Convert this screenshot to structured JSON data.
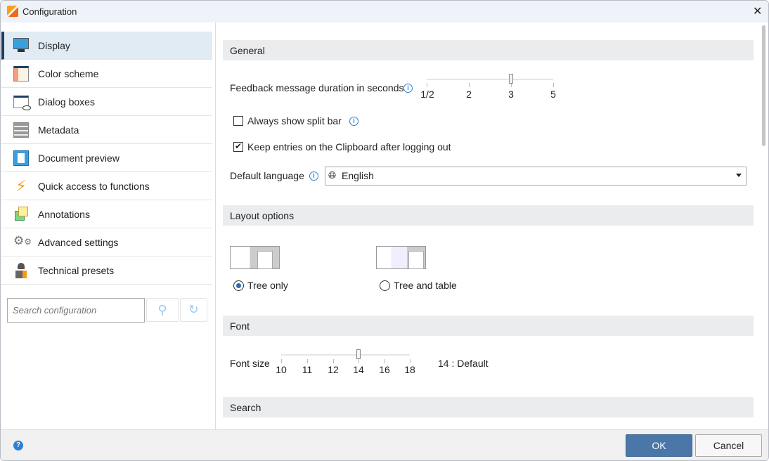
{
  "window": {
    "title": "Configuration",
    "close": "✕"
  },
  "sidebar": {
    "items": [
      {
        "label": "Display",
        "icon": "monitor-icon",
        "selected": true
      },
      {
        "label": "Color scheme",
        "icon": "color-scheme-icon"
      },
      {
        "label": "Dialog boxes",
        "icon": "dialog-eye-icon"
      },
      {
        "label": "Metadata",
        "icon": "metadata-icon"
      },
      {
        "label": "Document preview",
        "icon": "document-icon"
      },
      {
        "label": "Quick access to functions",
        "icon": "lightning-icon"
      },
      {
        "label": "Annotations",
        "icon": "sticky-note-icon"
      },
      {
        "label": "Advanced settings",
        "icon": "gears-icon"
      },
      {
        "label": "Technical presets",
        "icon": "technician-icon"
      }
    ],
    "search_placeholder": "Search configuration"
  },
  "general": {
    "title": "General",
    "feedback_label": "Feedback message duration in seconds",
    "feedback_ticks": [
      "1/2",
      "2",
      "3",
      "5"
    ],
    "feedback_value": "3",
    "split_bar_label": "Always show split bar",
    "split_bar_checked": false,
    "clipboard_label": "Keep entries on the Clipboard after logging out",
    "clipboard_checked": true,
    "language_label": "Default language",
    "language_value": "English"
  },
  "layout": {
    "title": "Layout options",
    "options": [
      {
        "label": "Tree only",
        "selected": true
      },
      {
        "label": "Tree and table",
        "selected": false
      }
    ]
  },
  "font": {
    "title": "Font",
    "size_label": "Font size",
    "ticks": [
      "10",
      "11",
      "12",
      "14",
      "16",
      "18"
    ],
    "value": "14",
    "value_text": "14 : Default"
  },
  "search": {
    "title": "Search"
  },
  "footer": {
    "ok": "OK",
    "cancel": "Cancel"
  },
  "colors": {
    "accent": "#4a76a8",
    "selected_bg": "#e1ebf3",
    "info": "#2b7fd4"
  }
}
